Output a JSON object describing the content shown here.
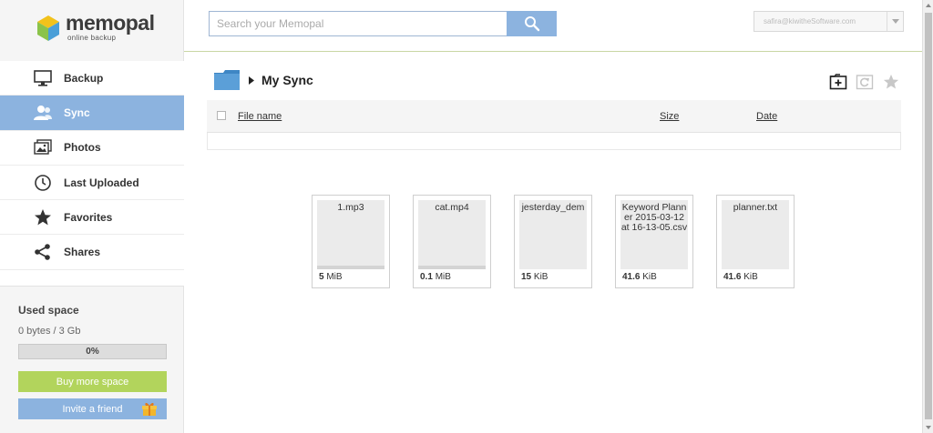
{
  "logo": {
    "word": "memopal",
    "tagline": "online backup"
  },
  "nav": {
    "items": [
      {
        "label": "Backup",
        "icon": "monitor-icon",
        "active": false
      },
      {
        "label": "Sync",
        "icon": "users-icon",
        "active": true
      },
      {
        "label": "Photos",
        "icon": "photos-icon",
        "active": false
      },
      {
        "label": "Last Uploaded",
        "icon": "clock-icon",
        "active": false
      },
      {
        "label": "Favorites",
        "icon": "star-icon",
        "active": false
      },
      {
        "label": "Shares",
        "icon": "share-icon",
        "active": false
      }
    ]
  },
  "space": {
    "title": "Used space",
    "usage": "0 bytes / 3 Gb",
    "percent_label": "0%",
    "percent": 0,
    "buy_label": "Buy more space",
    "invite_label": "Invite a friend"
  },
  "search": {
    "placeholder": "Search your Memopal"
  },
  "account": {
    "email": "safira@kiwitheSoftware.com"
  },
  "folder": {
    "title": "My Sync"
  },
  "table": {
    "columns": {
      "name": "File name",
      "size": "Size",
      "date": "Date"
    }
  },
  "files": [
    {
      "name": "1.mp3",
      "size_num": "5",
      "size_unit": "MiB"
    },
    {
      "name": "cat.mp4",
      "size_num": "0.1",
      "size_unit": "MiB"
    },
    {
      "name": "jesterday_dem",
      "size_num": "15",
      "size_unit": "KiB"
    },
    {
      "name": "Keyword Planner 2015-03-12 at 16-13-05.csv",
      "size_num": "41.6",
      "size_unit": "KiB"
    },
    {
      "name": "planner.txt",
      "size_num": "41.6",
      "size_unit": "KiB"
    }
  ],
  "colors": {
    "accent": "#8cb3df",
    "buy": "#b2d45c",
    "logo_cube_blue": "#4a9fd8",
    "logo_cube_yellow": "#f2c21b",
    "logo_cube_green": "#8bc34a"
  }
}
